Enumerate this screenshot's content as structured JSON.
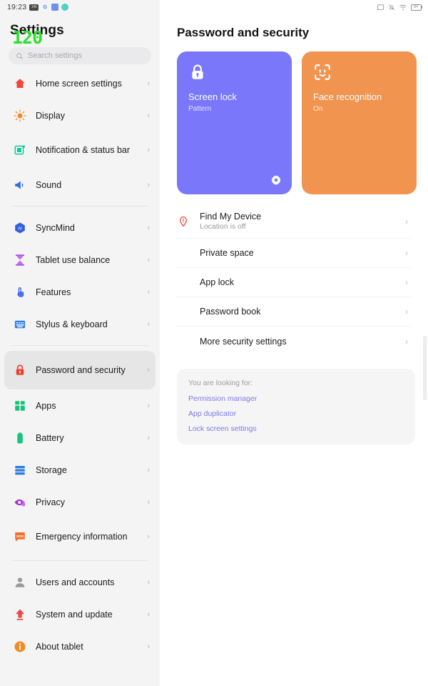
{
  "statusbar": {
    "time": "19:23",
    "notification_badge": "14h",
    "app_icons": [
      "G",
      "",
      ""
    ],
    "right_icons": [
      "cast-icon",
      "bell-off-icon",
      "wifi-icon",
      "battery-icon"
    ],
    "battery_level": "84"
  },
  "overlay": {
    "fps_counter": "120",
    "fps_color": "#2ee02e"
  },
  "sidebar": {
    "title": "Settings",
    "search": {
      "placeholder": "Search settings",
      "value": ""
    },
    "groups": [
      {
        "items": [
          {
            "label": "Home screen settings",
            "icon": "home-icon",
            "selected": false
          },
          {
            "label": "Display",
            "icon": "sun-icon",
            "selected": false
          },
          {
            "label": "Notification & status bar",
            "icon": "notification-icon",
            "selected": false
          },
          {
            "label": "Sound",
            "icon": "speaker-icon",
            "selected": false
          }
        ]
      },
      {
        "items": [
          {
            "label": "SyncMind",
            "icon": "ai-hexagon-icon",
            "selected": false
          },
          {
            "label": "Tablet use balance",
            "icon": "hourglass-icon",
            "selected": false
          },
          {
            "label": "Features",
            "icon": "hand-tap-icon",
            "selected": false
          },
          {
            "label": "Stylus & keyboard",
            "icon": "keyboard-icon",
            "selected": false
          }
        ]
      },
      {
        "items": [
          {
            "label": "Password and security",
            "icon": "lock-icon",
            "selected": true
          },
          {
            "label": "Apps",
            "icon": "apps-grid-icon",
            "selected": false
          },
          {
            "label": "Battery",
            "icon": "battery-icon",
            "selected": false
          },
          {
            "label": "Storage",
            "icon": "storage-icon",
            "selected": false
          },
          {
            "label": "Privacy",
            "icon": "eye-lock-icon",
            "selected": false
          },
          {
            "label": "Emergency information",
            "icon": "sos-icon",
            "selected": false
          }
        ]
      },
      {
        "items": [
          {
            "label": "Users and accounts",
            "icon": "person-icon",
            "selected": false
          },
          {
            "label": "System and update",
            "icon": "arrow-up-icon",
            "selected": false
          },
          {
            "label": "About tablet",
            "icon": "info-icon",
            "selected": false
          }
        ]
      }
    ],
    "chevron": "›"
  },
  "main": {
    "title": "Password and security",
    "cards": [
      {
        "title": "Screen lock",
        "subtitle": "Pattern",
        "color": "#7a77fb",
        "icon": "padlock-icon",
        "has_gear": true
      },
      {
        "title": "Face recognition",
        "subtitle": "On",
        "color": "#f1944f",
        "icon": "face-id-icon",
        "has_gear": false
      }
    ],
    "rows": [
      {
        "title": "Find My Device",
        "subtitle": "Location is off",
        "icon": "location-pin-alert-icon"
      },
      {
        "title": "Private space",
        "subtitle": "",
        "icon": ""
      },
      {
        "title": "App lock",
        "subtitle": "",
        "icon": ""
      },
      {
        "title": "Password book",
        "subtitle": "",
        "icon": ""
      },
      {
        "title": "More security settings",
        "subtitle": "",
        "icon": ""
      }
    ],
    "looking_for": {
      "label": "You are looking for:",
      "links": [
        "Permission manager",
        "App duplicator",
        "Lock screen settings"
      ]
    },
    "chevron": "›"
  }
}
